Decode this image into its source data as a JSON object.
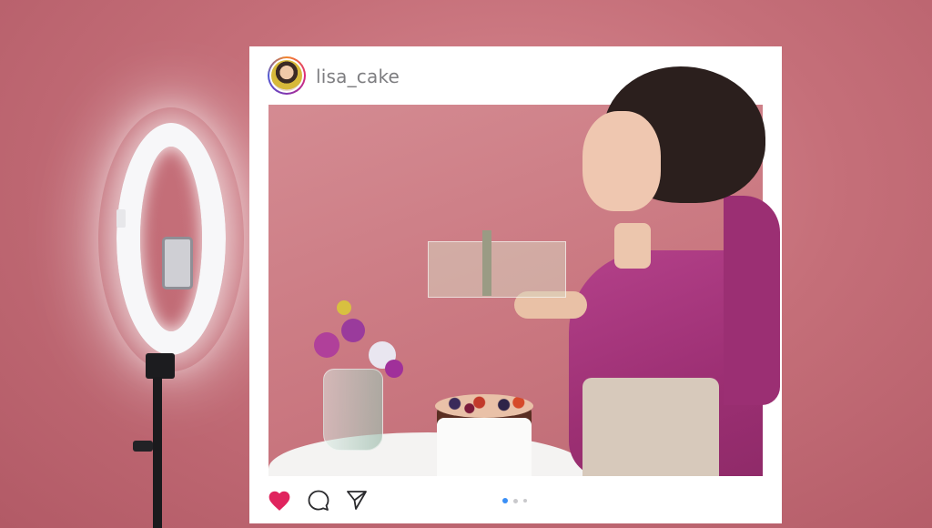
{
  "post": {
    "username": "lisa_cake",
    "carousel": {
      "count": 3,
      "active_index": 0
    },
    "actions": {
      "like": "heart-icon",
      "comment": "comment-icon",
      "share": "share-icon"
    },
    "colors": {
      "like": "#e0245e",
      "active_dot": "#3a8ff6",
      "background": "#c56f79"
    }
  }
}
